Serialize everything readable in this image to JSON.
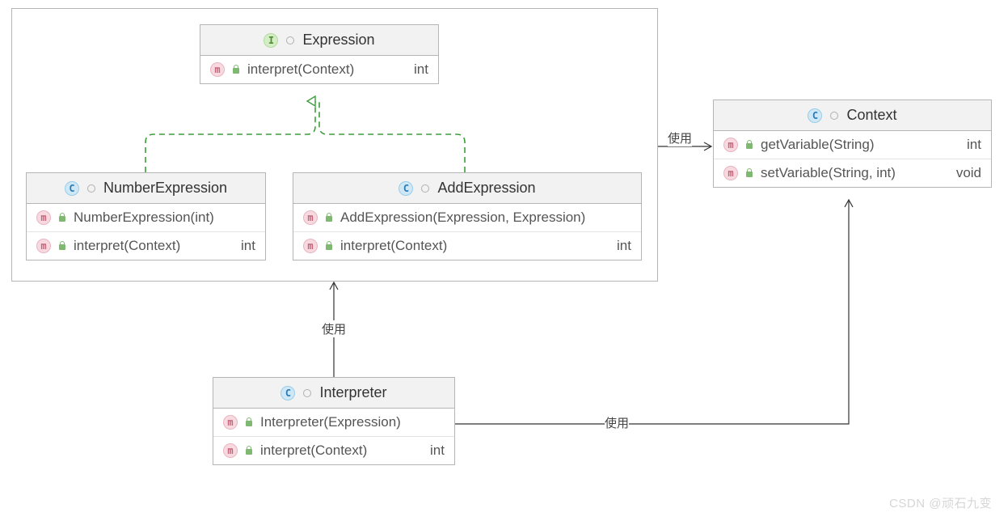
{
  "container": {},
  "expression": {
    "title": "Expression",
    "m1_sig": "interpret(Context)",
    "m1_ret": "int"
  },
  "numberExpression": {
    "title": "NumberExpression",
    "m1_sig": "NumberExpression(int)",
    "m2_sig": "interpret(Context)",
    "m2_ret": "int"
  },
  "addExpression": {
    "title": "AddExpression",
    "m1_sig": "AddExpression(Expression, Expression)",
    "m2_sig": "interpret(Context)",
    "m2_ret": "int"
  },
  "interpreter": {
    "title": "Interpreter",
    "m1_sig": "Interpreter(Expression)",
    "m2_sig": "interpret(Context)",
    "m2_ret": "int"
  },
  "context": {
    "title": "Context",
    "m1_sig": "getVariable(String)",
    "m1_ret": "int",
    "m2_sig": "setVariable(String, int)",
    "m2_ret": "void"
  },
  "labels": {
    "use1": "使用",
    "use2": "使用",
    "use3": "使用"
  },
  "watermark": "CSDN @顽石九变"
}
